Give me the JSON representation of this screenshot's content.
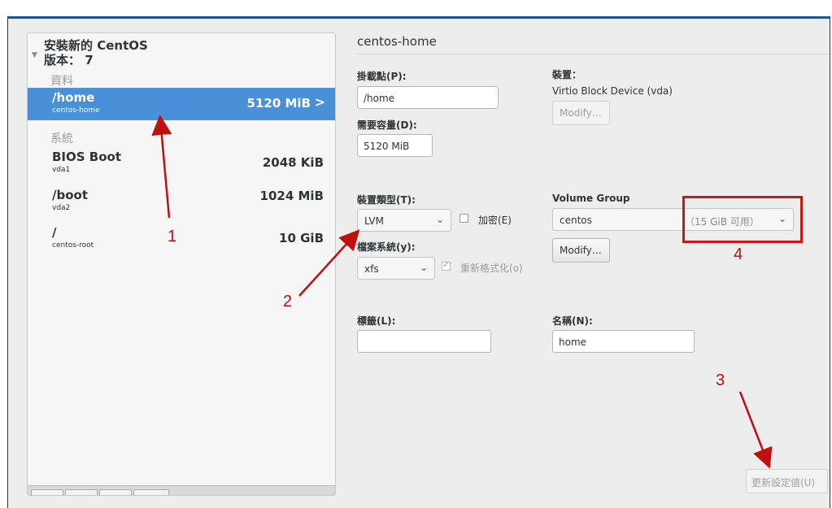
{
  "left": {
    "title_line1": "安裝新的 CentOS",
    "title_line2": "版本： 7",
    "group_data": "資料",
    "group_system": "系統",
    "partitions": [
      {
        "name": "/home",
        "sub": "centos-home",
        "size": "5120 MiB",
        "selected": true
      },
      {
        "name": "BIOS Boot",
        "sub": "vda1",
        "size": "2048 KiB",
        "selected": false
      },
      {
        "name": "/boot",
        "sub": "vda2",
        "size": "1024 MiB",
        "selected": false
      },
      {
        "name": "/",
        "sub": "centos-root",
        "size": "10 GiB",
        "selected": false
      }
    ]
  },
  "right": {
    "title": "centos-home",
    "mount_label": "掛載點(P):",
    "mount_value": "/home",
    "capacity_label": "需要容量(D):",
    "capacity_value": "5120 MiB",
    "device_label": "裝置：",
    "device_value": "Virtio Block Device (vda)",
    "device_modify": "Modify…",
    "device_type_label": "裝置類型(T):",
    "device_type_value": "LVM",
    "encrypt_label": "加密(E)",
    "fs_label": "檔案系統(y):",
    "fs_value": "xfs",
    "reformat_label": "重新格式化(o)",
    "vg_label": "Volume Group",
    "vg_value": "centos",
    "vg_free": "（15 GiB 可用）",
    "vg_modify": "Modify…",
    "tag_label": "標籤(L):",
    "tag_value": "",
    "name_label": "名稱(N):",
    "name_value": "home",
    "update_button": "更新設定值(U)"
  },
  "annotations": [
    "1",
    "2",
    "3",
    "4"
  ],
  "colors": {
    "accent": "#4a90d9",
    "annotation": "#c0100e",
    "topbar": "#1b57a0"
  }
}
